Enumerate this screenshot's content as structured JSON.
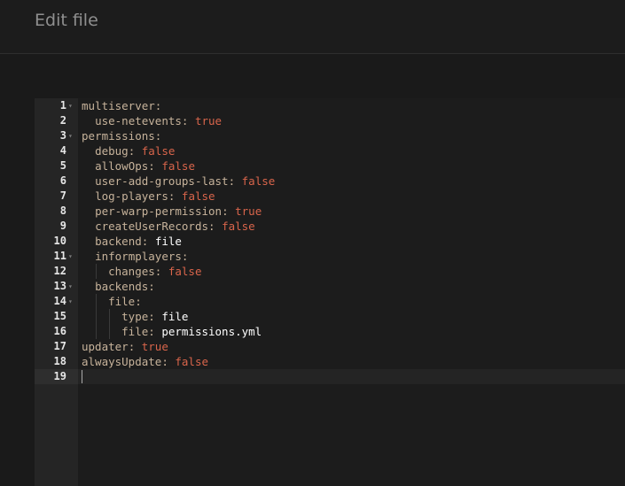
{
  "header": {
    "title": "Edit file"
  },
  "editor": {
    "lines": [
      {
        "num": "1",
        "fold": true,
        "indent": "",
        "key": "multiserver",
        "value": ""
      },
      {
        "num": "2",
        "fold": false,
        "indent": "  ",
        "key": "use-netevents",
        "value": "true"
      },
      {
        "num": "3",
        "fold": true,
        "indent": "",
        "key": "permissions",
        "value": ""
      },
      {
        "num": "4",
        "fold": false,
        "indent": "  ",
        "key": "debug",
        "value": "false"
      },
      {
        "num": "5",
        "fold": false,
        "indent": "  ",
        "key": "allowOps",
        "value": "false"
      },
      {
        "num": "6",
        "fold": false,
        "indent": "  ",
        "key": "user-add-groups-last",
        "value": "false"
      },
      {
        "num": "7",
        "fold": false,
        "indent": "  ",
        "key": "log-players",
        "value": "false"
      },
      {
        "num": "8",
        "fold": false,
        "indent": "  ",
        "key": "per-warp-permission",
        "value": "true"
      },
      {
        "num": "9",
        "fold": false,
        "indent": "  ",
        "key": "createUserRecords",
        "value": "false"
      },
      {
        "num": "10",
        "fold": false,
        "indent": "  ",
        "key": "backend",
        "value": "file"
      },
      {
        "num": "11",
        "fold": true,
        "indent": "  ",
        "key": "informplayers",
        "value": ""
      },
      {
        "num": "12",
        "fold": false,
        "indent": "    ",
        "key": "changes",
        "value": "false"
      },
      {
        "num": "13",
        "fold": true,
        "indent": "  ",
        "key": "backends",
        "value": ""
      },
      {
        "num": "14",
        "fold": true,
        "indent": "    ",
        "key": "file",
        "value": ""
      },
      {
        "num": "15",
        "fold": false,
        "indent": "      ",
        "key": "type",
        "value": "file"
      },
      {
        "num": "16",
        "fold": false,
        "indent": "      ",
        "key": "file",
        "value": "permissions.yml"
      },
      {
        "num": "17",
        "fold": false,
        "indent": "",
        "key": "updater",
        "value": "true"
      },
      {
        "num": "18",
        "fold": false,
        "indent": "",
        "key": "alwaysUpdate",
        "value": "false"
      },
      {
        "num": "19",
        "fold": false,
        "indent": "",
        "key": "",
        "value": ""
      }
    ],
    "active_line": "19",
    "fold_icon": "fold-arrow-icon",
    "colors": {
      "key": "#c7b39b",
      "keyword_value": "#d9654b",
      "string_value": "#ffffff",
      "gutter_bg": "#252525",
      "editor_bg": "#1c1c1c"
    }
  }
}
